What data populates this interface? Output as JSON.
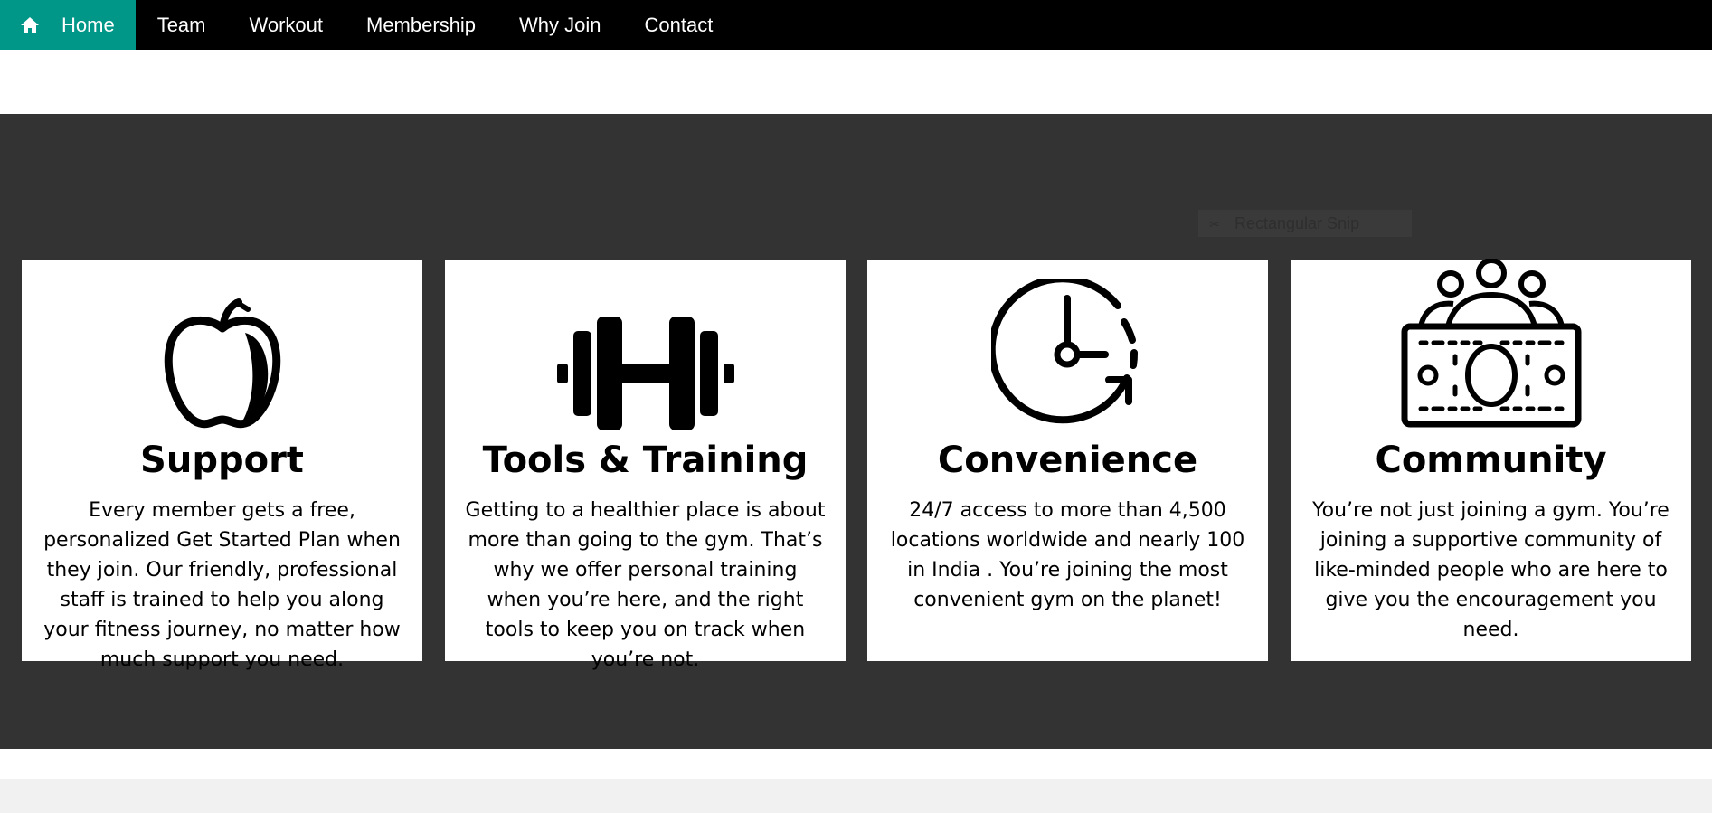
{
  "nav": {
    "items": [
      {
        "label": "Home",
        "icon": "home-icon",
        "active": true
      },
      {
        "label": "Team"
      },
      {
        "label": "Workout"
      },
      {
        "label": "Membership"
      },
      {
        "label": "Why Join"
      },
      {
        "label": "Contact"
      }
    ],
    "active_color": "#009688"
  },
  "tooltip": {
    "text": "Rectangular Snip"
  },
  "features": [
    {
      "icon": "apple-icon",
      "title": "Support",
      "text": "Every member gets a free, personalized Get Started Plan when they join. Our friendly, professional staff is trained to help you along your fitness journey, no matter how much support you need."
    },
    {
      "icon": "dumbbell-icon",
      "title": "Tools & Training",
      "text": "Getting to a healthier place is about more than going to the gym. That’s why we offer personal training when you’re here, and the right tools to keep you on track when you’re not."
    },
    {
      "icon": "clock-icon",
      "title": "Convenience",
      "text": "24/7 access to more than 4,500 locations worldwide and nearly 100 in India . You’re joining the most convenient gym on the planet!"
    },
    {
      "icon": "community-icon",
      "title": "Community",
      "text": "You’re not just joining a gym. You’re joining a supportive community of like-minded people who are here to give you the encouragement you need."
    }
  ]
}
